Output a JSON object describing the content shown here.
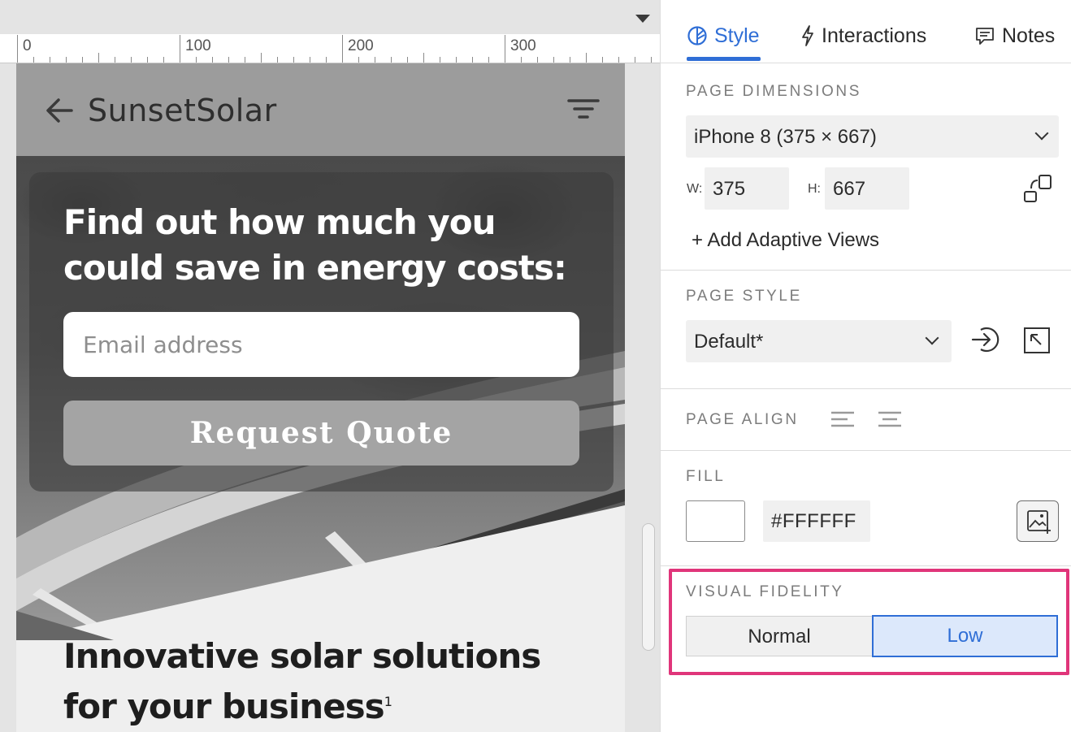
{
  "canvas": {
    "ruler_labels": [
      "0",
      "100",
      "200",
      "300"
    ]
  },
  "phone": {
    "app_title": "SunsetSolar",
    "quote_heading": "Find out how much you could save in energy costs:",
    "email_placeholder": "Email address",
    "quote_button_label": "Request Quote",
    "tagline": "Innovative solar solutions for your business",
    "tagline_footnote": "1"
  },
  "inspector": {
    "tabs": [
      {
        "label": "Style",
        "icon": "style-icon",
        "active": true
      },
      {
        "label": "Interactions",
        "icon": "lightning-icon",
        "active": false
      },
      {
        "label": "Notes",
        "icon": "comment-icon",
        "active": false
      }
    ],
    "page_dimensions": {
      "label": "PAGE DIMENSIONS",
      "device_value": "iPhone 8  (375 × 667)",
      "width_label": "W:",
      "width_value": "375",
      "height_label": "H:",
      "height_value": "667",
      "add_adaptive_views": "+ Add Adaptive Views"
    },
    "page_style": {
      "label": "PAGE STYLE",
      "value": "Default*"
    },
    "page_align": {
      "label": "PAGE ALIGN"
    },
    "fill": {
      "label": "FILL",
      "color": "#FFFFFF",
      "hex_text": "#FFFFFF"
    },
    "visual_fidelity": {
      "label": "VISUAL FIDELITY",
      "options": [
        "Normal",
        "Low"
      ],
      "selected": "Low",
      "highlight_color": "#e0357a"
    }
  },
  "colors": {
    "accent": "#2f6ed6",
    "header_gray": "#9c9c9c"
  }
}
